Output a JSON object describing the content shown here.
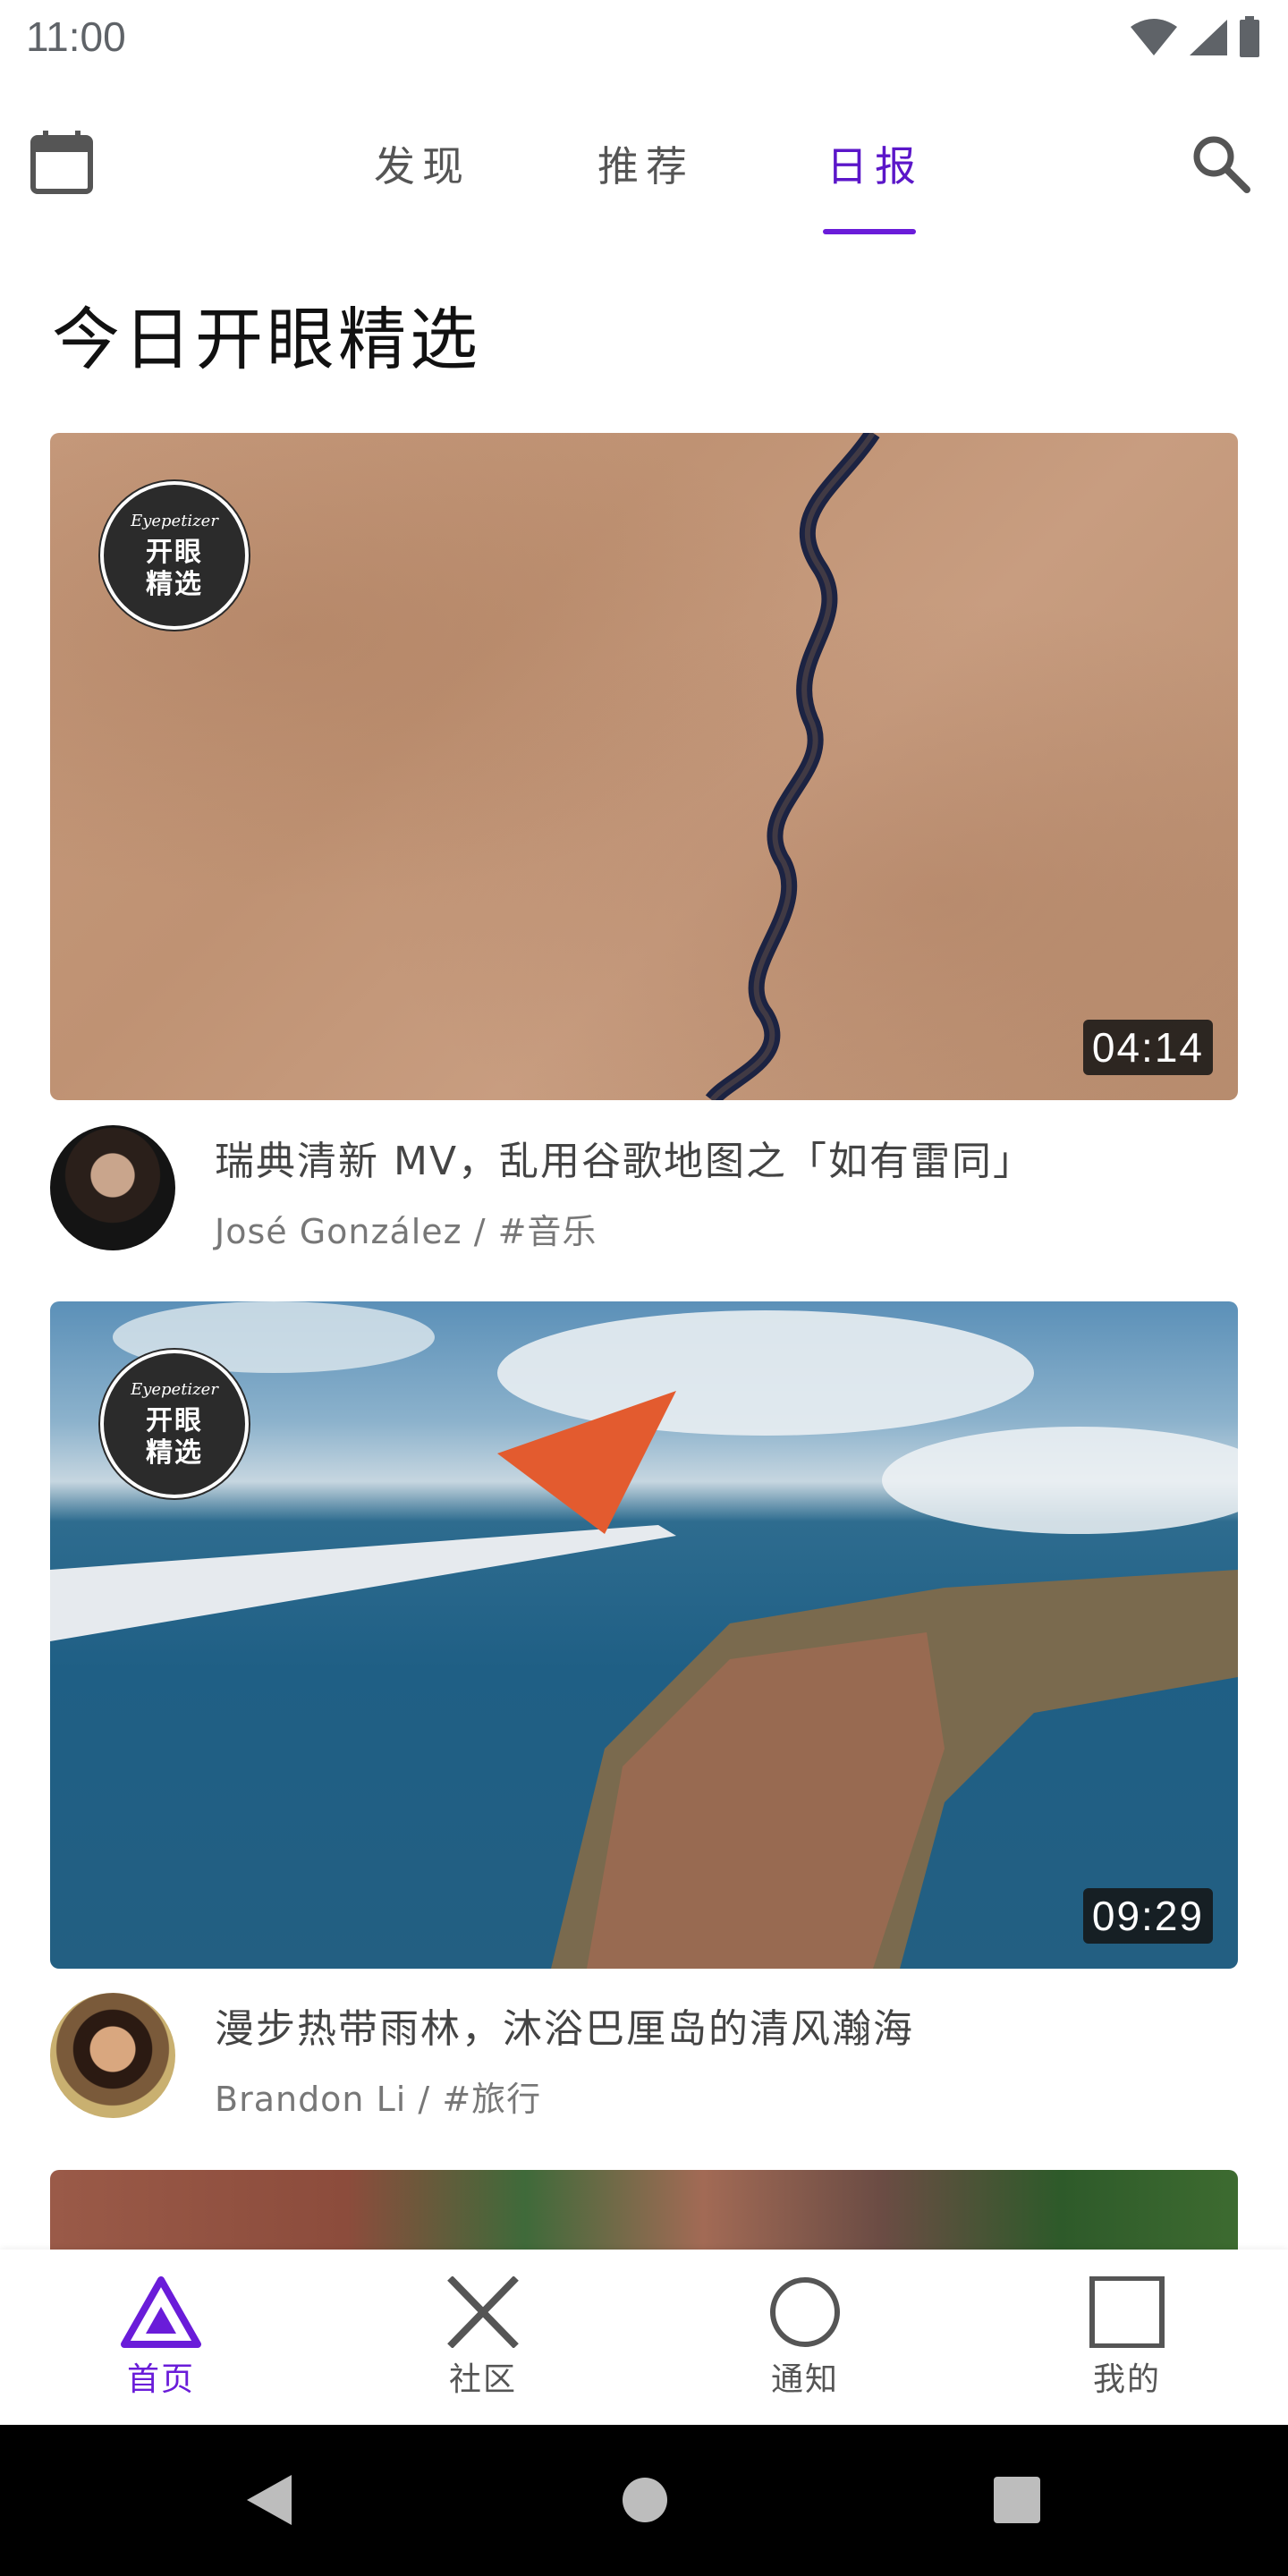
{
  "status_bar": {
    "time": "11:00"
  },
  "top_nav": {
    "tabs": [
      {
        "label": "发现"
      },
      {
        "label": "推荐"
      },
      {
        "label": "日报"
      }
    ],
    "active_tab": "日报",
    "accent_color": "#6a1cd9"
  },
  "page": {
    "title": "今日开眼精选"
  },
  "badge": {
    "brand_script": "Eyepetizer",
    "line1": "开眼",
    "line2": "精选"
  },
  "videos": [
    {
      "duration": "04:14",
      "title": "瑞典清新 MV，乱用谷歌地图之「如有雷同」",
      "author": "José González",
      "tag": "#音乐"
    },
    {
      "duration": "09:29",
      "title": "漫步热带雨林，沐浴巴厘岛的清风瀚海",
      "author": "Brandon Li",
      "tag": "#旅行"
    }
  ],
  "bottom_nav": {
    "items": [
      {
        "label": "首页",
        "icon": "triangle-icon"
      },
      {
        "label": "社区",
        "icon": "cross-icon"
      },
      {
        "label": "通知",
        "icon": "circle-icon"
      },
      {
        "label": "我的",
        "icon": "square-icon"
      }
    ],
    "active_item": "首页"
  }
}
